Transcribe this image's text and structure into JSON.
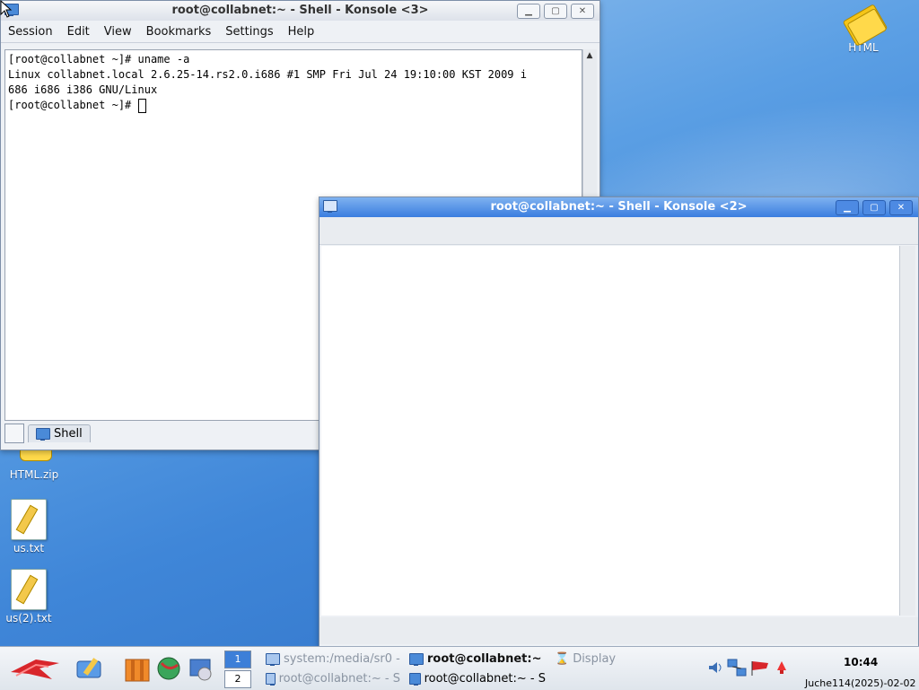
{
  "desktop": {
    "icons": [
      {
        "label": "HTML"
      },
      {
        "label": "HTML.zip"
      },
      {
        "label": "us.txt"
      },
      {
        "label": "us(2).txt"
      }
    ]
  },
  "konsole3": {
    "title": "root@collabnet:~ - Shell - Konsole <3>",
    "menu": [
      "Session",
      "Edit",
      "View",
      "Bookmarks",
      "Settings",
      "Help"
    ],
    "lines": [
      "[root@collabnet ~]# uname -a",
      "Linux collabnet.local 2.6.25-14.rs2.0.i686 #1 SMP Fri Jul 24 19:10:00 KST 2009 i",
      "686 i686 i386 GNU/Linux",
      "[root@collabnet ~]# "
    ],
    "tab_label": "Shell"
  },
  "konsole2": {
    "title": "root@collabnet:~ - Shell - Konsole <2>"
  },
  "taskbar": {
    "pager": [
      "1",
      "2"
    ],
    "tasks": [
      {
        "label": "system:/media/sr0 -"
      },
      {
        "label": "root@collabnet:~"
      },
      {
        "label": "Display"
      },
      {
        "label": "root@collabnet:~ - S"
      },
      {
        "label": "root@collabnet:~ - S"
      }
    ],
    "clock": "10:44",
    "date": "Juche114(2025)-02-02"
  }
}
